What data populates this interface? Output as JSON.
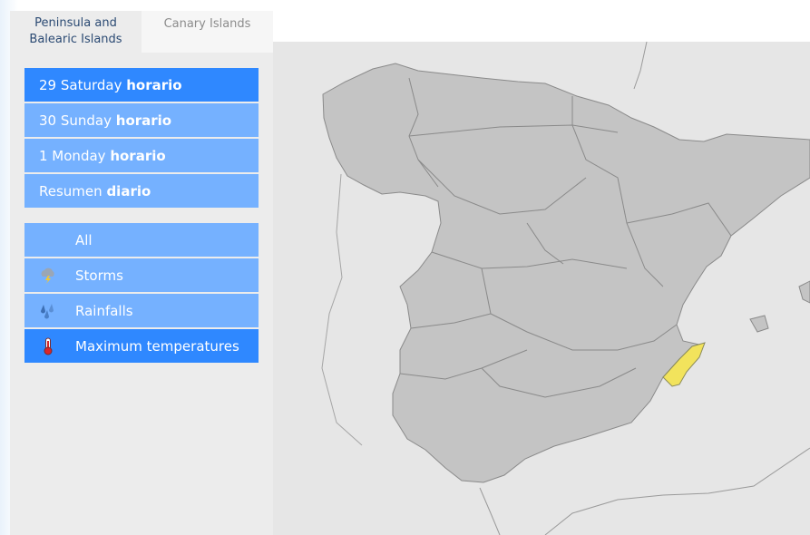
{
  "tabs": [
    {
      "label": "Peninsula and Balearic Islands",
      "active": true
    },
    {
      "label": "Canary Islands",
      "active": false
    }
  ],
  "days": [
    {
      "day": "29 Saturday",
      "suffix": "horario",
      "active": true
    },
    {
      "day": "30 Sunday",
      "suffix": "horario",
      "active": false
    },
    {
      "day": "1 Monday",
      "suffix": "horario",
      "active": false
    },
    {
      "day": "Resumen",
      "suffix": "diario",
      "active": false
    }
  ],
  "filters": [
    {
      "label": "All",
      "icon": "none",
      "active": false
    },
    {
      "label": "Storms",
      "icon": "storm-icon",
      "active": false
    },
    {
      "label": "Rainfalls",
      "icon": "rain-icon",
      "active": false
    },
    {
      "label": "Maximum temperatures",
      "icon": "thermometer-icon",
      "active": true
    }
  ],
  "colors": {
    "active": "#2f88ff",
    "inactive": "#75b1ff",
    "land": "#c4c4c4",
    "sea": "#e6e6e6",
    "warning_yellow": "#f2e35c"
  },
  "map": {
    "highlighted_region_warning_level": "yellow"
  }
}
